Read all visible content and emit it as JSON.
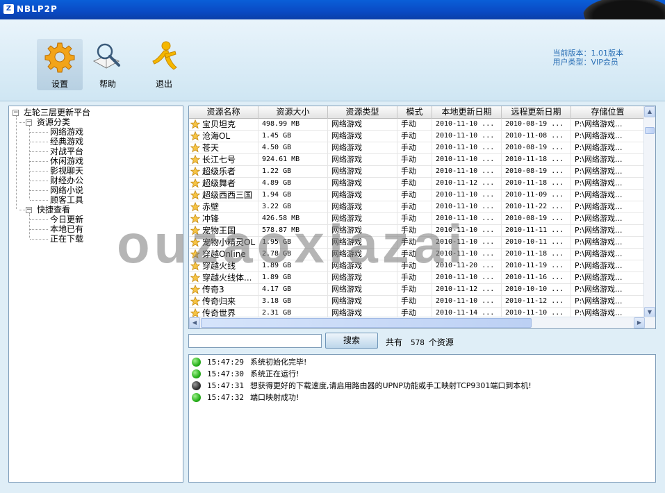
{
  "window": {
    "title": "NBLP2P"
  },
  "toolbar": {
    "buttons": [
      {
        "label": "设置",
        "icon": "gear-icon"
      },
      {
        "label": "帮助",
        "icon": "magnifier-book-icon"
      },
      {
        "label": "退出",
        "icon": "exit-runner-icon"
      }
    ],
    "version_line": "当前版本：1.01版本",
    "user_line": "用户类型：VIP会员"
  },
  "tree": {
    "root": "左轮三层更新平台",
    "groups": [
      {
        "label": "资源分类",
        "items": [
          "网络游戏",
          "经典游戏",
          "对战平台",
          "休闲游戏",
          "影视聊天",
          "财经办公",
          "网络小说",
          "顾客工具"
        ]
      },
      {
        "label": "快捷查看",
        "items": [
          "今日更新",
          "本地已有",
          "正在下载"
        ]
      }
    ]
  },
  "grid": {
    "columns": [
      "资源名称",
      "资源大小",
      "资源类型",
      "模式",
      "本地更新日期",
      "远程更新日期",
      "存储位置"
    ],
    "rows": [
      [
        "宝贝坦克",
        "498.99 MB",
        "网络游戏",
        "手动",
        "2010-11-10 ...",
        "2010-08-19 ...",
        "P:\\网络游戏..."
      ],
      [
        "沧海OL",
        "1.45 GB",
        "网络游戏",
        "手动",
        "2010-11-10 ...",
        "2010-11-08 ...",
        "P:\\网络游戏..."
      ],
      [
        "苍天",
        "4.50 GB",
        "网络游戏",
        "手动",
        "2010-11-10 ...",
        "2010-08-19 ...",
        "P:\\网络游戏..."
      ],
      [
        "长江七号",
        "924.61 MB",
        "网络游戏",
        "手动",
        "2010-11-10 ...",
        "2010-11-18 ...",
        "P:\\网络游戏..."
      ],
      [
        "超级乐者",
        "1.22 GB",
        "网络游戏",
        "手动",
        "2010-11-10 ...",
        "2010-08-19 ...",
        "P:\\网络游戏..."
      ],
      [
        "超级舞者",
        "4.89 GB",
        "网络游戏",
        "手动",
        "2010-11-12 ...",
        "2010-11-18 ...",
        "P:\\网络游戏..."
      ],
      [
        "超级西西三国",
        "1.94 GB",
        "网络游戏",
        "手动",
        "2010-11-10 ...",
        "2010-11-09 ...",
        "P:\\网络游戏..."
      ],
      [
        "赤壁",
        "3.22 GB",
        "网络游戏",
        "手动",
        "2010-11-10 ...",
        "2010-11-22 ...",
        "P:\\网络游戏..."
      ],
      [
        "冲锋",
        "426.58 MB",
        "网络游戏",
        "手动",
        "2010-11-10 ...",
        "2010-08-19 ...",
        "P:\\网络游戏..."
      ],
      [
        "宠物王国",
        "578.87 MB",
        "网络游戏",
        "手动",
        "2010-11-10 ...",
        "2010-11-11 ...",
        "P:\\网络游戏..."
      ],
      [
        "宠物小精灵OL",
        "1.95 GB",
        "网络游戏",
        "手动",
        "2010-11-10 ...",
        "2010-10-11 ...",
        "P:\\网络游戏..."
      ],
      [
        "穿越Online",
        "2.78 GB",
        "网络游戏",
        "手动",
        "2010-11-10 ...",
        "2010-11-18 ...",
        "P:\\网络游戏..."
      ],
      [
        "穿越火线",
        "1.89 GB",
        "网络游戏",
        "手动",
        "2010-11-20 ...",
        "2010-11-19 ...",
        "P:\\网络游戏..."
      ],
      [
        "穿越火线体...",
        "1.89 GB",
        "网络游戏",
        "手动",
        "2010-11-10 ...",
        "2010-11-16 ...",
        "P:\\网络游戏..."
      ],
      [
        "传奇3",
        "4.17 GB",
        "网络游戏",
        "手动",
        "2010-11-12 ...",
        "2010-10-10 ...",
        "P:\\网络游戏..."
      ],
      [
        "传奇归来",
        "3.18 GB",
        "网络游戏",
        "手动",
        "2010-11-10 ...",
        "2010-11-12 ...",
        "P:\\网络游戏..."
      ],
      [
        "传奇世界",
        "2.31 GB",
        "网络游戏",
        "手动",
        "2010-11-14 ...",
        "2010-11-10 ...",
        "P:\\网络游戏..."
      ]
    ]
  },
  "search": {
    "value": "",
    "button_label": "搜索",
    "total_prefix": "共有",
    "total_count": "578",
    "total_suffix": "个资源"
  },
  "log": [
    {
      "time": "15:47:29",
      "message": "系统初始化完毕!",
      "status": "green"
    },
    {
      "time": "15:47:30",
      "message": "系统正在运行!",
      "status": "green"
    },
    {
      "time": "15:47:31",
      "message": "想获得更好的下载速度,请启用路由器的UPNP功能或手工映射TCP9301端口到本机!",
      "status": "dark"
    },
    {
      "time": "15:47:32",
      "message": "端口映射成功!",
      "status": "green"
    }
  ],
  "watermark": "ouzaoxiazai",
  "colors": {
    "titlebar": "#0a4ac4",
    "accent_text": "#2a6fb5",
    "status_ok": "#27b01a"
  }
}
